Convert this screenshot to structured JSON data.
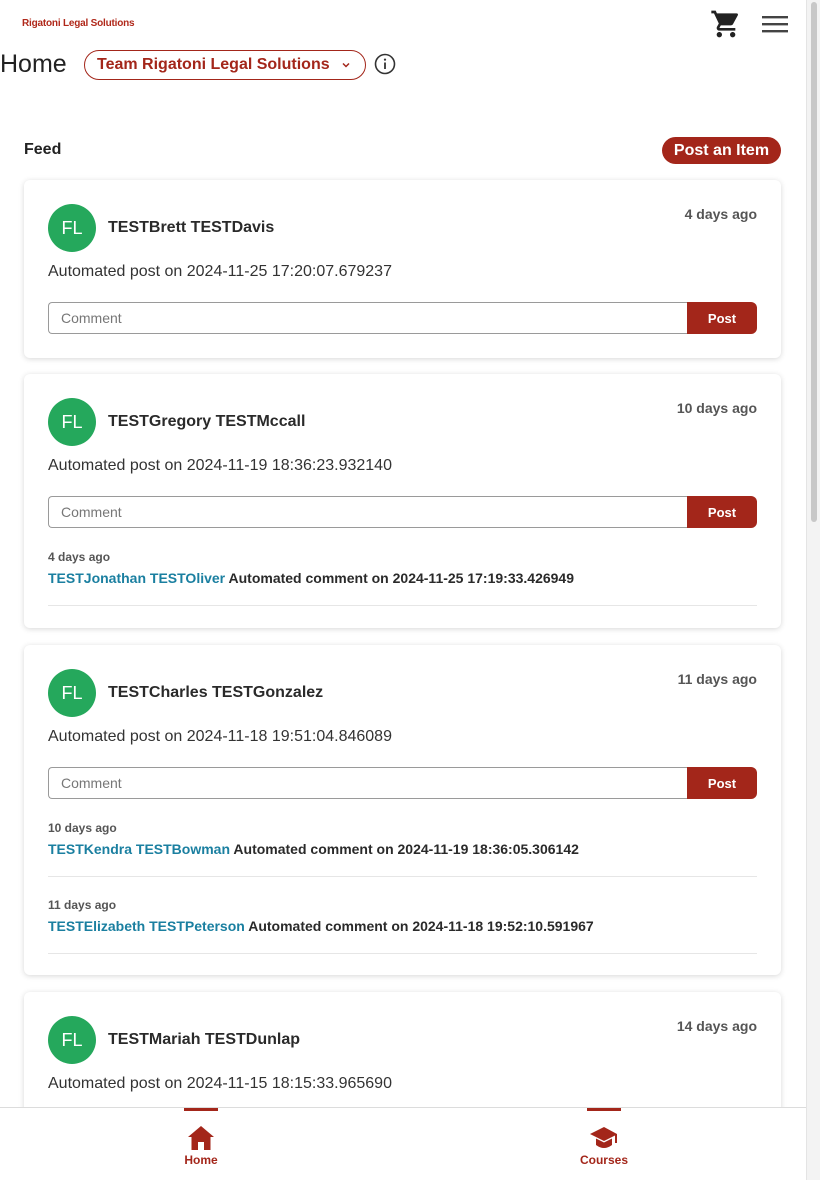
{
  "header": {
    "logo_text": "Rigatoni Legal Solutions",
    "cart_icon": "shopping-cart-icon",
    "menu_icon": "hamburger-menu-icon"
  },
  "page": {
    "title": "Home",
    "team_selector": "Team Rigatoni Legal Solutions",
    "info_icon": "info-icon"
  },
  "feed": {
    "label": "Feed",
    "post_item_button": "Post an Item",
    "comment_placeholder": "Comment",
    "comment_button": "Post",
    "posts": [
      {
        "initials": "FL",
        "author": "TESTBrett TESTDavis",
        "time": "4 days ago",
        "text": "Automated post on 2024-11-25 17:20:07.679237",
        "comments": []
      },
      {
        "initials": "FL",
        "author": "TESTGregory TESTMccall",
        "time": "10 days ago",
        "text": "Automated post on 2024-11-19 18:36:23.932140",
        "comments": [
          {
            "time": "4 days ago",
            "author": "TESTJonathan TESTOliver",
            "text": "Automated comment on 2024-11-25 17:19:33.426949"
          }
        ]
      },
      {
        "initials": "FL",
        "author": "TESTCharles TESTGonzalez",
        "time": "11 days ago",
        "text": "Automated post on 2024-11-18 19:51:04.846089",
        "comments": [
          {
            "time": "10 days ago",
            "author": "TESTKendra TESTBowman",
            "text": "Automated comment on 2024-11-19 18:36:05.306142"
          },
          {
            "time": "11 days ago",
            "author": "TESTElizabeth TESTPeterson",
            "text": "Automated comment on 2024-11-18 19:52:10.591967"
          }
        ]
      },
      {
        "initials": "FL",
        "author": "TESTMariah TESTDunlap",
        "time": "14 days ago",
        "text": "Automated post on 2024-11-15 18:15:33.965690",
        "comments": []
      }
    ]
  },
  "bottom_nav": {
    "items": [
      {
        "label": "Home",
        "icon": "home-icon",
        "active": true
      },
      {
        "label": "Courses",
        "icon": "graduation-cap-icon",
        "active": true
      }
    ]
  },
  "colors": {
    "brand": "#a3261a",
    "avatar": "#25a85c",
    "link": "#1a7fa0"
  }
}
